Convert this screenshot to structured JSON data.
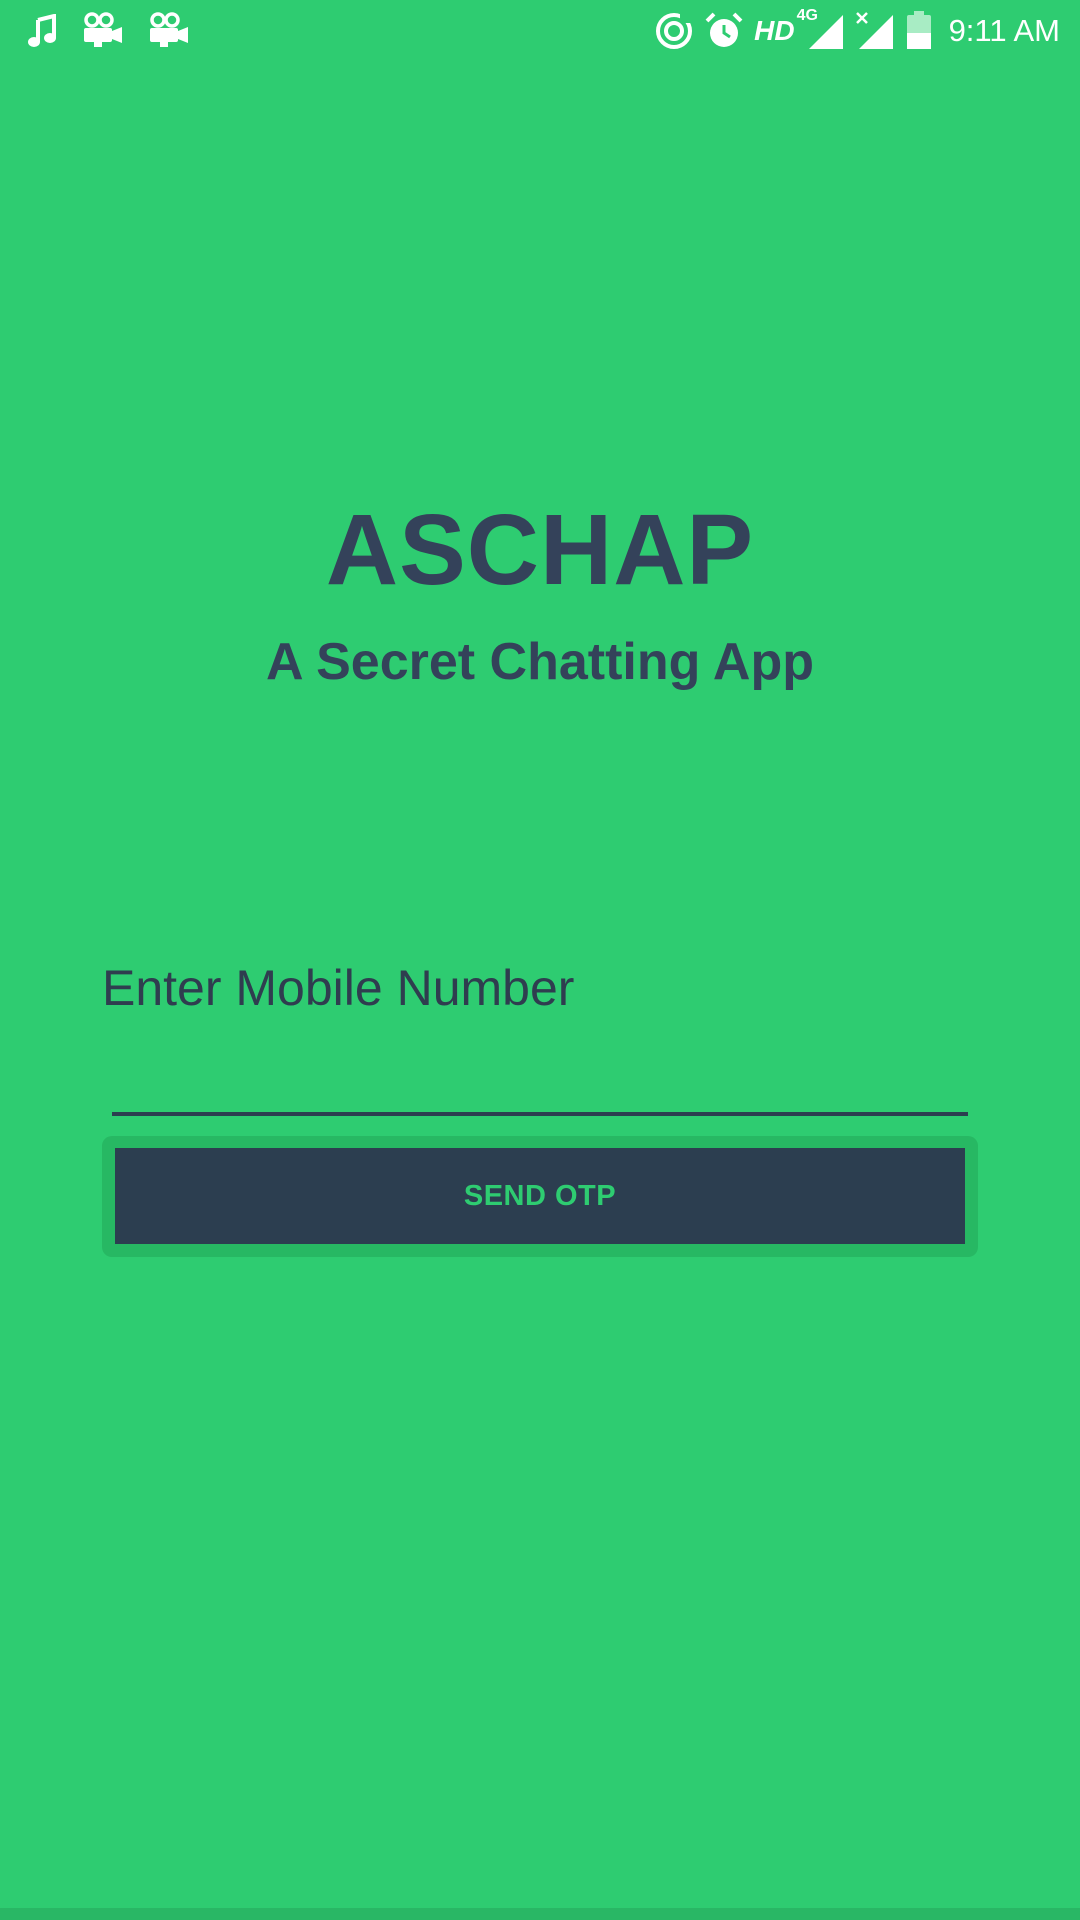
{
  "status_bar": {
    "left_icons": [
      "music-note-icon",
      "movie-camera-icon",
      "movie-camera-icon"
    ],
    "right_icons": [
      "data-saver-icon",
      "alarm-icon",
      "hd-label",
      "signal-4g-icon",
      "signal-no-sim-icon",
      "battery-icon"
    ],
    "hd_label": "HD",
    "network_label": "4G",
    "time": "9:11 AM",
    "icon_color": "#ffffff"
  },
  "app": {
    "title": "ASCHAP",
    "subtitle": "A Secret Chatting App"
  },
  "form": {
    "mobile_label": "Enter Mobile Number",
    "mobile_value": "",
    "send_button_label": "SEND OTP"
  },
  "colors": {
    "background": "#2ecc71",
    "text_dark": "#34425a",
    "button_bg": "#2c3e50",
    "button_text": "#2ecc71"
  }
}
